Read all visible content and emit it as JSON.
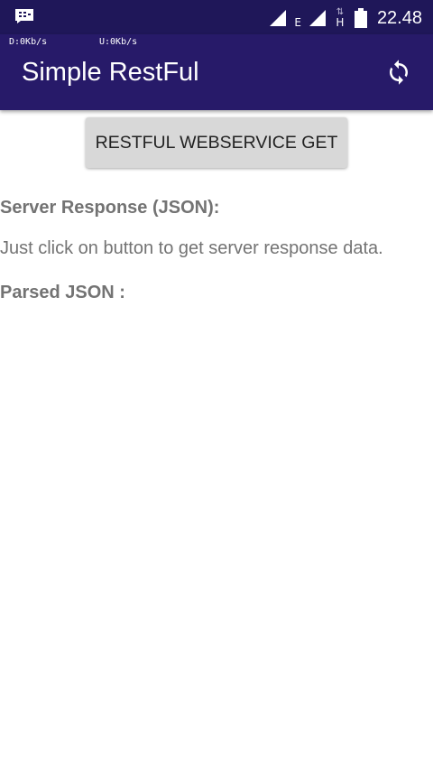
{
  "status_bar": {
    "notification_icon": "bbm-chat-icon",
    "signal_1_icon": "signal-icon",
    "network_type_1": "E",
    "signal_2_icon": "signal-icon",
    "data_arrows": "⇅",
    "network_type_2": "H",
    "battery_icon": "battery-icon",
    "time": "22.48"
  },
  "app_bar": {
    "speed_down": "D:0Kb/s",
    "speed_up": "U:0Kb/s",
    "title": "Simple RestFul",
    "refresh_icon": "refresh-icon"
  },
  "main": {
    "get_button_label": "RESTFUL WEBSERVICE GET",
    "server_response_label": "Server Response (JSON):",
    "server_response_text": "Just click on button to get server response data.",
    "parsed_json_label": "Parsed JSON :"
  },
  "colors": {
    "status_bar": "#1f1759",
    "app_bar": "#271a69",
    "button": "#d8d8d8",
    "text_gray": "#737373"
  }
}
